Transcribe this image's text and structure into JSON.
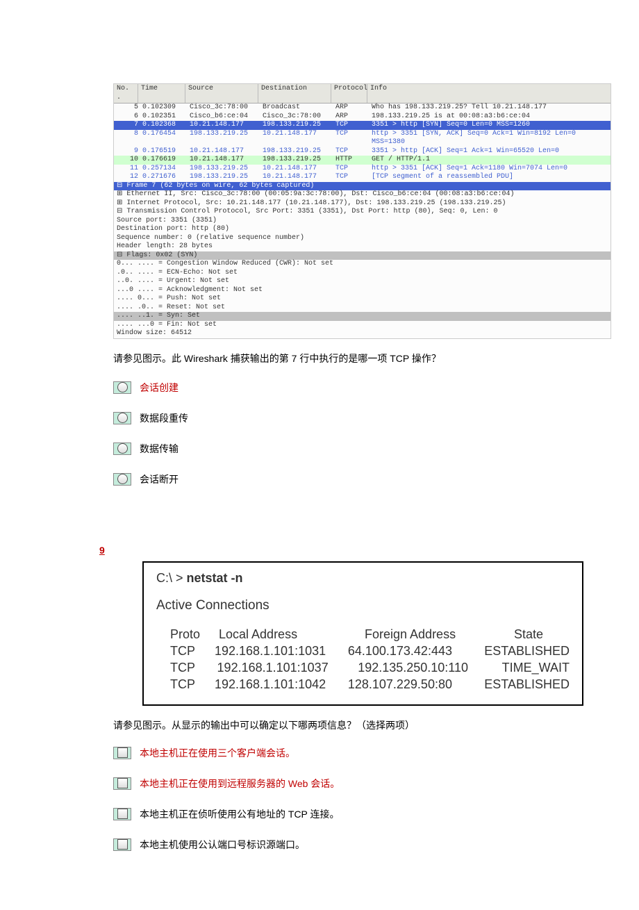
{
  "wireshark": {
    "headers": {
      "no": "No. .",
      "time": "Time",
      "src": "Source",
      "dst": "Destination",
      "proto": "Protocol",
      "info": "Info"
    },
    "rows": [
      {
        "no": "5",
        "time": "0.102309",
        "src": "Cisco_3c:78:00",
        "dst": "Broadcast",
        "proto": "ARP",
        "info": "Who has 198.133.219.25?  Tell 10.21.148.177",
        "cls": ""
      },
      {
        "no": "6",
        "time": "0.102351",
        "src": "Cisco_b6:ce:04",
        "dst": "Cisco_3c:78:00",
        "proto": "ARP",
        "info": "198.133.219.25 is at 00:08:a3:b6:ce:04",
        "cls": ""
      },
      {
        "no": "7",
        "time": "0.102368",
        "src": "10.21.148.177",
        "dst": "198.133.219.25",
        "proto": "TCP",
        "info": "3351 > http [SYN] Seq=0 Len=0 MSS=1260",
        "cls": "sel"
      },
      {
        "no": "8",
        "time": "0.176454",
        "src": "198.133.219.25",
        "dst": "10.21.148.177",
        "proto": "TCP",
        "info": "http > 3351 [SYN, ACK] Seq=0 Ack=1 Win=8192 Len=0 MSS=1380",
        "cls": "tcp"
      },
      {
        "no": "9",
        "time": "0.176519",
        "src": "10.21.148.177",
        "dst": "198.133.219.25",
        "proto": "TCP",
        "info": "3351 > http [ACK] Seq=1 Ack=1 Win=65520 Len=0",
        "cls": "tcp"
      },
      {
        "no": "10",
        "time": "0.176619",
        "src": "10.21.148.177",
        "dst": "198.133.219.25",
        "proto": "HTTP",
        "info": "GET / HTTP/1.1",
        "cls": "http"
      },
      {
        "no": "11",
        "time": "0.257134",
        "src": "198.133.219.25",
        "dst": "10.21.148.177",
        "proto": "TCP",
        "info": "http > 3351 [ACK] Seq=1 Ack=1180 Win=7074 Len=0",
        "cls": "tcp"
      },
      {
        "no": "12",
        "time": "0.271676",
        "src": "198.133.219.25",
        "dst": "10.21.148.177",
        "proto": "TCP",
        "info": "[TCP segment of a reassembled PDU]",
        "cls": "tcp"
      }
    ],
    "detail": {
      "frame_line": "⊟ Frame 7 (62 bytes on wire, 62 bytes captured)",
      "eth": "⊞ Ethernet II, Src: Cisco_3c:78:00 (00:05:9a:3c:78:00), Dst: Cisco_b6:ce:04 (00:08:a3:b6:ce:04)",
      "ip": "⊞ Internet Protocol, Src: 10.21.148.177 (10.21.148.177), Dst: 198.133.219.25 (198.133.219.25)",
      "tcp": "⊟ Transmission Control Protocol, Src Port: 3351 (3351), Dst Port: http (80), Seq: 0, Len: 0",
      "sport": "    Source port: 3351 (3351)",
      "dport": "    Destination port: http (80)",
      "seq": "    Sequence number: 0    (relative sequence number)",
      "hlen": "    Header length: 28 bytes",
      "flags": "  ⊟ Flags: 0x02 (SYN)",
      "cwr": "      0... .... = Congestion Window Reduced (CWR): Not set",
      "ecn": "      .0.. .... = ECN-Echo: Not set",
      "urg": "      ..0. .... = Urgent: Not set",
      "ack": "      ...0 .... = Acknowledgment: Not set",
      "psh": "      .... 0... = Push: Not set",
      "rst": "      .... .0.. = Reset: Not set",
      "syn": "      .... ..1. = Syn: Set",
      "fin": "      .... ...0 = Fin: Not set",
      "win": "    Window size: 64512"
    }
  },
  "q8": {
    "question": "请参见图示。此 Wireshark 捕获输出的第 7 行中执行的是哪一项 TCP 操作？",
    "options": [
      {
        "text": "会话创建",
        "correct": true
      },
      {
        "text": "数据段重传",
        "correct": false
      },
      {
        "text": "数据传输",
        "correct": false
      },
      {
        "text": "会话断开",
        "correct": false
      }
    ]
  },
  "q9": {
    "number": "9",
    "netstat": {
      "cmd_prefix": "C:\\ > ",
      "cmd": "netstat -n",
      "subtitle": "Active Connections",
      "headers": {
        "proto": "Proto",
        "local": "Local Address",
        "foreign": "Foreign Address",
        "state": "State"
      },
      "rows": [
        {
          "proto": "TCP",
          "local": "192.168.1.101:1031",
          "foreign": "64.100.173.42:443",
          "state": "ESTABLISHED"
        },
        {
          "proto": "TCP",
          "local": "192.168.1.101:1037",
          "foreign": "192.135.250.10:110",
          "state": "TIME_WAIT"
        },
        {
          "proto": "TCP",
          "local": "192.168.1.101:1042",
          "foreign": "128.107.229.50:80",
          "state": "ESTABLISHED"
        }
      ]
    },
    "question": "请参见图示。从显示的输出中可以确定以下哪两项信息？（选择两项）",
    "options": [
      {
        "text": "本地主机正在使用三个客户端会话。",
        "correct": true
      },
      {
        "text": "本地主机正在使用到远程服务器的 Web 会话。",
        "correct": true
      },
      {
        "text": "本地主机正在侦听使用公有地址的 TCP 连接。",
        "correct": false
      },
      {
        "text": "本地主机使用公认端口号标识源端口。",
        "correct": false
      }
    ]
  }
}
